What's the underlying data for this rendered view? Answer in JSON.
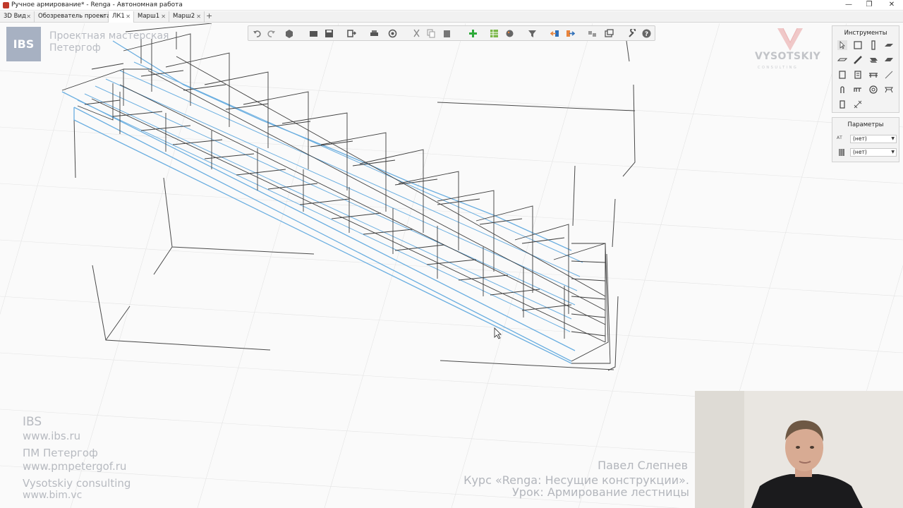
{
  "window": {
    "title": "Ручное армирование* - Renga - Автономная работа",
    "buttons": {
      "minimize": "—",
      "maximize": "❐",
      "close": "✕"
    }
  },
  "tabs": [
    {
      "label": "3D Вид",
      "active": false
    },
    {
      "label": "Обозреватель проекта",
      "active": false
    },
    {
      "label": "ЛК1",
      "active": true
    },
    {
      "label": "Марш1",
      "active": false
    },
    {
      "label": "Марш2",
      "active": false
    }
  ],
  "tab_close_glyph": "✕",
  "tab_add_glyph": "+",
  "toolbar": {
    "icons": [
      "undo-icon",
      "redo-icon",
      "view-cube-icon",
      "folder-icon",
      "save-icon",
      "export-icon",
      "print-icon",
      "orbit-icon",
      "cut-icon",
      "copy-icon",
      "paste-icon",
      "add-icon",
      "table-icon",
      "paint-icon",
      "filter-icon",
      "import-icon",
      "export-arrow-icon",
      "group-icon",
      "layers-icon",
      "settings-wrench-icon",
      "help-icon"
    ]
  },
  "tools_panel": {
    "title": "Инструменты",
    "icons": [
      "select-icon",
      "wall-icon",
      "column-icon",
      "slab-icon",
      "beam-icon",
      "brace-icon",
      "stair-icon",
      "roof-icon",
      "foundation-icon",
      "opening-icon",
      "room-icon",
      "railing-icon",
      "line-icon",
      "rebar-icon",
      "mesh-icon",
      "profile-icon",
      "detail-icon",
      "annotation-icon"
    ]
  },
  "params_panel": {
    "title": "Параметры",
    "rows": [
      {
        "icon": "text-style-icon",
        "icon_text": "АТ",
        "value": "(нет)"
      },
      {
        "icon": "material-icon",
        "icon_text": "",
        "value": "(нет)"
      }
    ]
  },
  "ibs_logo": {
    "text": "IBS",
    "caption_line1": "Проектная мастерская",
    "caption_line2": "Петергоф"
  },
  "vc_logo": {
    "name": "VYSOTSKIY",
    "sub": "CONSULTING"
  },
  "watermark_left": {
    "line1": "IBS",
    "line2": "www.ibs.ru",
    "line3": "ПМ Петергоф",
    "line4": "www.pmpetergof.ru",
    "line5": "Vysotskiy consulting",
    "line6": "www.bim.vc"
  },
  "watermark_right": {
    "author": "Павел Слепнев",
    "course": "Курс «Renga: Несущие конструкции».",
    "lesson": "Урок: Армирование лестницы"
  },
  "colors": {
    "accent_blue": "#6aaee0",
    "rebar_dark": "#3d3d3d",
    "panel_bg": "#f3f3f3",
    "watermark": "#b7bac0"
  }
}
